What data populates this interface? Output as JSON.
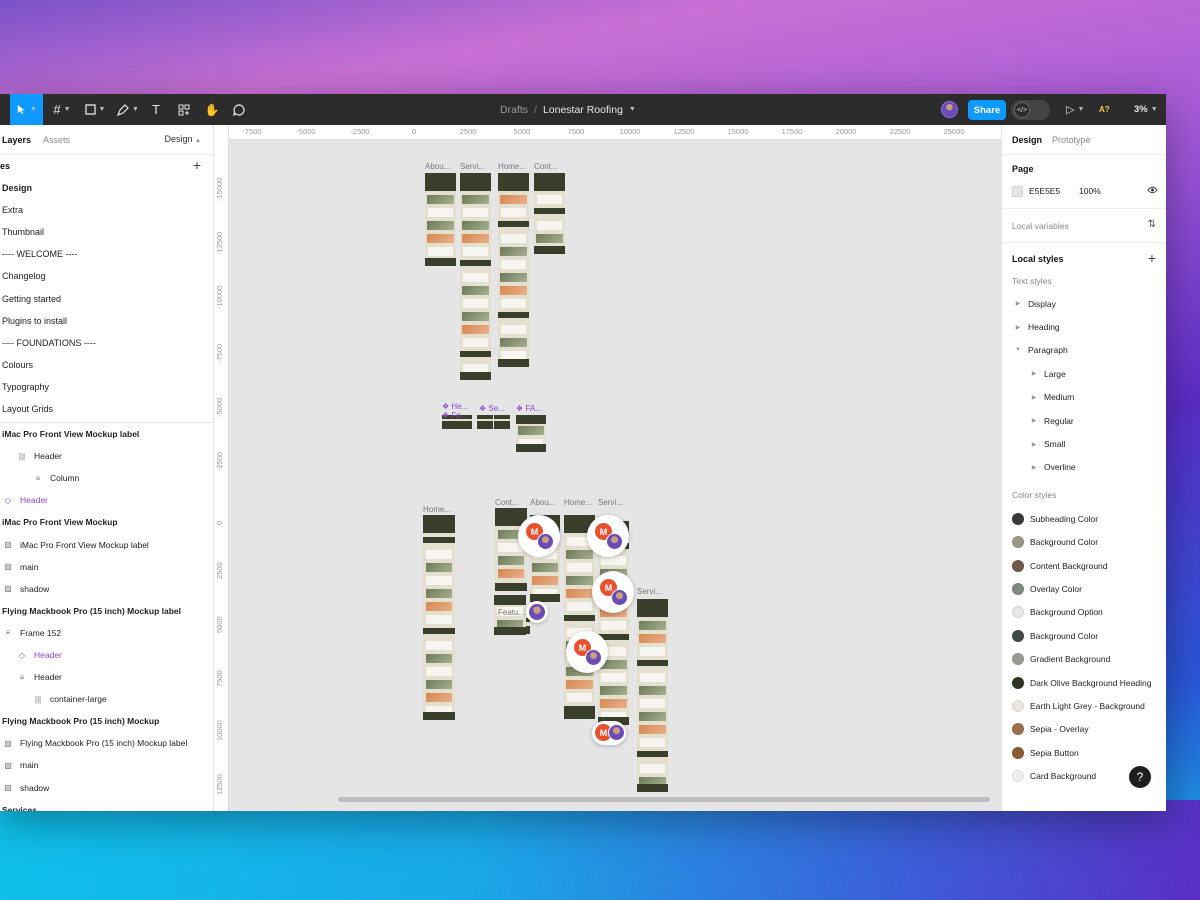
{
  "toolbar": {
    "tools": [
      "move-tool",
      "frame-tool",
      "shape-tool",
      "pen-tool",
      "text-tool",
      "resources-tool",
      "hand-tool",
      "comment-tool"
    ],
    "breadcrumb_parent": "Drafts",
    "breadcrumb_sep": "/",
    "file_name": "Lonestar Roofing",
    "share_label": "Share",
    "dev_mode_glyph": "</>",
    "ai_label": "A?",
    "zoom": "3%"
  },
  "left_panel": {
    "tab_layers": "Layers",
    "tab_assets": "Assets",
    "design_switch": "Design",
    "pages_title": "es",
    "pages": [
      "Design",
      "Extra",
      "Thumbnail",
      "---- WELCOME ----",
      "Changelog",
      "Getting started",
      "Plugins to install",
      "---- FOUNDATIONS ----",
      "Colours",
      "Typography",
      "Layout Grids"
    ],
    "layers": [
      {
        "label": "iMac Pro Front View Mockup label",
        "icon": "",
        "type": "bold"
      },
      {
        "label": "Header",
        "icon": "|||",
        "type": "child"
      },
      {
        "label": "Column",
        "icon": "≡",
        "type": "grandchild"
      },
      {
        "label": "Header",
        "icon": "◇",
        "type": "comp"
      },
      {
        "label": "iMac Pro Front View Mockup",
        "icon": "",
        "type": "bold"
      },
      {
        "label": "iMac Pro Front View Mockup label",
        "icon": "▨",
        "type": "child"
      },
      {
        "label": "main",
        "icon": "▨",
        "type": "child"
      },
      {
        "label": "shadow",
        "icon": "▨",
        "type": "child"
      },
      {
        "label": "Flying Mackbook Pro (15 inch) Mockup label",
        "icon": "",
        "type": "bold"
      },
      {
        "label": "Frame 152",
        "icon": "≡",
        "type": "root"
      },
      {
        "label": "Header",
        "icon": "◇",
        "type": "comp"
      },
      {
        "label": "Header",
        "icon": "≡",
        "type": "child"
      },
      {
        "label": "container-large",
        "icon": "|||",
        "type": "grandchild"
      },
      {
        "label": "Flying Mackbook Pro (15 inch) Mockup",
        "icon": "",
        "type": "bold"
      },
      {
        "label": "Flying Mackbook Pro (15 inch) Mockup label",
        "icon": "▨",
        "type": "child"
      },
      {
        "label": "main",
        "icon": "▨",
        "type": "child"
      },
      {
        "label": "shadow",
        "icon": "▨",
        "type": "child"
      },
      {
        "label": "Services",
        "icon": "",
        "type": "bold"
      }
    ]
  },
  "canvas": {
    "ruler_x": [
      "-7500",
      "-5000",
      "-2500",
      "0",
      "2500",
      "5000",
      "7500",
      "10000",
      "12500",
      "15000",
      "17500",
      "20000",
      "22500",
      "25000"
    ],
    "ruler_y": [
      "-15000",
      "-12500",
      "-10000",
      "-7500",
      "-5000",
      "-2500",
      "0",
      "2500",
      "5000",
      "7500",
      "10000",
      "12500"
    ],
    "frame_labels": [
      "Abou...",
      "Servi...",
      "Home...",
      "Cont...",
      "❖ He...",
      "❖ Fo...",
      "❖ Se...",
      "❖ FA...",
      "Home...",
      "Cont...",
      "Abou...",
      "Home...",
      "Servi...",
      "Featu...",
      "Servi..."
    ],
    "collaborator_initial": "M"
  },
  "right_panel": {
    "tab_design": "Design",
    "tab_prototype": "Prototype",
    "page_title": "Page",
    "page_color": "E5E5E5",
    "page_opacity": "100%",
    "local_variables": "Local variables",
    "local_styles": "Local styles",
    "text_styles_label": "Text styles",
    "text_styles": [
      {
        "label": "Display",
        "level": 0,
        "expanded": false
      },
      {
        "label": "Heading",
        "level": 0,
        "expanded": false
      },
      {
        "label": "Paragraph",
        "level": 0,
        "expanded": true
      },
      {
        "label": "Large",
        "level": 1,
        "expanded": false
      },
      {
        "label": "Medium",
        "level": 1,
        "expanded": false
      },
      {
        "label": "Regular",
        "level": 1,
        "expanded": false
      },
      {
        "label": "Small",
        "level": 1,
        "expanded": false
      },
      {
        "label": "Overline",
        "level": 1,
        "expanded": false
      }
    ],
    "color_styles_label": "Color styles",
    "color_styles": [
      {
        "label": "Subheading Color",
        "color": "#3a3a3a"
      },
      {
        "label": "Background Color",
        "color": "#9a9888"
      },
      {
        "label": "Content Background",
        "color": "#6e5a4a"
      },
      {
        "label": "Overlay Color",
        "color": "#7e8a80"
      },
      {
        "label": "Background Option",
        "color": "#e6e6e6"
      },
      {
        "label": "Background Color",
        "color": "#3e4a48"
      },
      {
        "label": "Gradient Background",
        "color": "#9a9a94"
      },
      {
        "label": "Dark Olive Background Heading",
        "color": "#2e3424"
      },
      {
        "label": "Earth Light Grey - Background",
        "color": "#ece6e0"
      },
      {
        "label": "Sepia - Overlay",
        "color": "#9c6e4e"
      },
      {
        "label": "Sepia Button",
        "color": "#8a5a34"
      },
      {
        "label": "Card Background",
        "color": "#efefef"
      }
    ],
    "help": "?"
  }
}
